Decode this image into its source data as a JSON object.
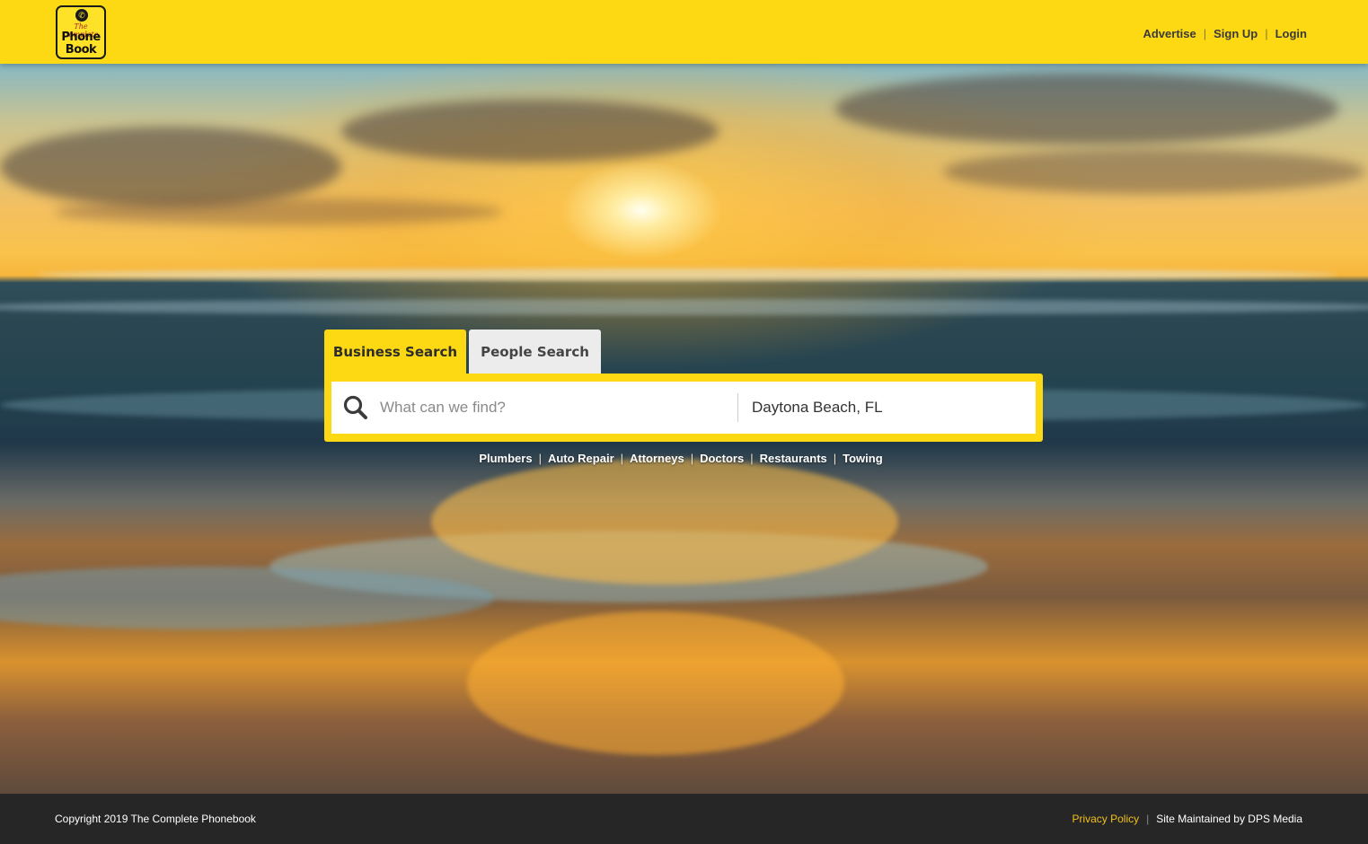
{
  "header": {
    "logo": {
      "line1": "The Complete",
      "line2": "Phone",
      "line3": "Book"
    },
    "nav": [
      {
        "label": "Advertise"
      },
      {
        "label": "Sign Up"
      },
      {
        "label": "Login"
      }
    ],
    "nav_separator": "|",
    "brand_color": "#fcd913"
  },
  "search": {
    "tabs": [
      {
        "label": "Business Search",
        "active": true
      },
      {
        "label": "People Search",
        "active": false
      }
    ],
    "what_placeholder": "What can we find?",
    "where_value": "Daytona Beach, FL",
    "search_icon": "magnifier-icon"
  },
  "quick_links": {
    "items": [
      "Plumbers",
      "Auto Repair",
      "Attorneys",
      "Doctors",
      "Restaurants",
      "Towing"
    ],
    "separator": "|"
  },
  "footer": {
    "copyright": "Copyright 2019 The Complete Phonebook",
    "privacy": "Privacy Policy",
    "separator": "|",
    "maintained": "Site Maintained by DPS Media",
    "privacy_color": "#f2c11c"
  }
}
